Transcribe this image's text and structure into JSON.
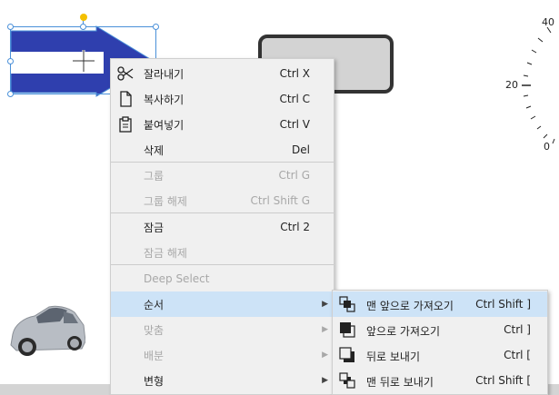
{
  "gauge": {
    "labels": [
      "40",
      "20",
      "0"
    ]
  },
  "context_menu": {
    "items": [
      {
        "label": "잘라내기",
        "shortcut": "Ctrl X",
        "icon": "scissors-icon",
        "enabled": true
      },
      {
        "label": "복사하기",
        "shortcut": "Ctrl C",
        "icon": "copy-icon",
        "enabled": true
      },
      {
        "label": "붙여넣기",
        "shortcut": "Ctrl V",
        "icon": "clipboard-icon",
        "enabled": true
      },
      {
        "label": "삭제",
        "shortcut": "Del",
        "enabled": true
      },
      {
        "label": "그룹",
        "shortcut": "Ctrl G",
        "enabled": false
      },
      {
        "label": "그룹 해제",
        "shortcut": "Ctrl Shift G",
        "enabled": false
      },
      {
        "label": "잠금",
        "shortcut": "Ctrl 2",
        "enabled": true
      },
      {
        "label": "잠금 해제",
        "shortcut": "",
        "enabled": false
      },
      {
        "label": "Deep Select",
        "shortcut": "",
        "enabled": false
      },
      {
        "label": "순서",
        "shortcut": "",
        "enabled": true,
        "submenu": true,
        "highlighted": true
      },
      {
        "label": "맞춤",
        "shortcut": "",
        "enabled": false,
        "submenu": true
      },
      {
        "label": "배분",
        "shortcut": "",
        "enabled": false,
        "submenu": true
      },
      {
        "label": "변형",
        "shortcut": "",
        "enabled": true,
        "submenu": true
      }
    ]
  },
  "order_submenu": {
    "items": [
      {
        "label": "맨 앞으로 가져오기",
        "shortcut": "Ctrl Shift ]",
        "icon": "bring-to-front-icon",
        "highlighted": true
      },
      {
        "label": "앞으로 가져오기",
        "shortcut": "Ctrl ]",
        "icon": "bring-forward-icon"
      },
      {
        "label": "뒤로 보내기",
        "shortcut": "Ctrl [",
        "icon": "send-backward-icon"
      },
      {
        "label": "맨 뒤로 보내기",
        "shortcut": "Ctrl Shift [",
        "icon": "send-to-back-icon"
      }
    ]
  },
  "colors": {
    "menu_bg": "#f0f0f0",
    "highlight": "#cde3f7",
    "arrow_fill": "#2f3fae",
    "selection": "#4a90d9",
    "disabled_text": "#a8a8a8"
  }
}
